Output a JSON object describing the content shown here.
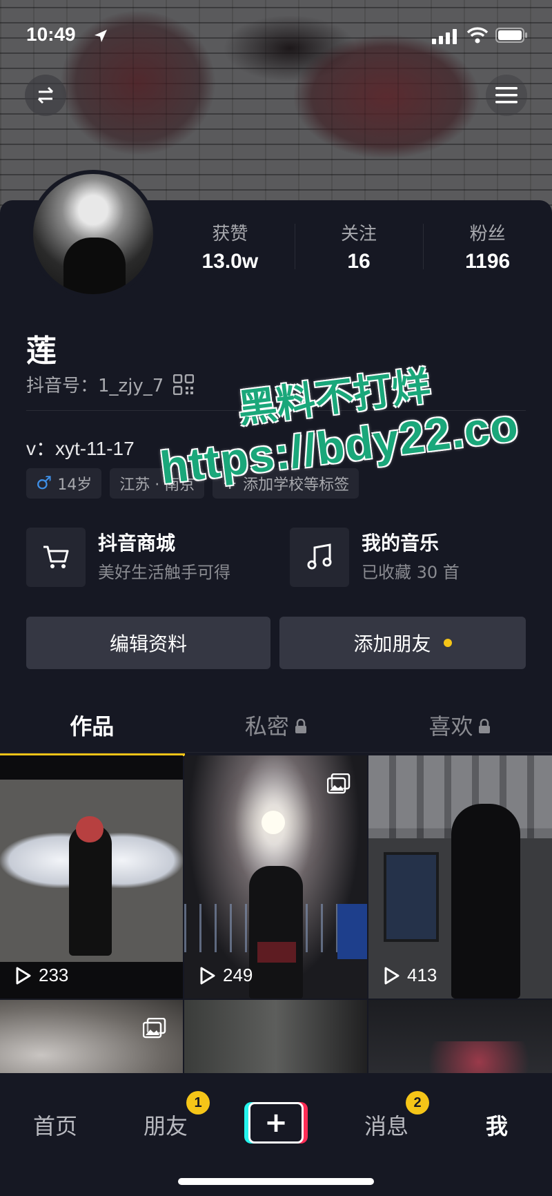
{
  "status_bar": {
    "time": "10:49"
  },
  "profile": {
    "nickname": "莲",
    "douyin_id": "抖音号：1_zjy_7",
    "bio": "v：xyt-11-17",
    "tags": {
      "age": "14岁",
      "location": "江苏 · 南京",
      "add_tag": "添加学校等标签"
    },
    "stats": [
      {
        "label": "获赞",
        "value": "13.0w"
      },
      {
        "label": "关注",
        "value": "16"
      },
      {
        "label": "粉丝",
        "value": "1196"
      }
    ]
  },
  "services": [
    {
      "title": "抖音商城",
      "subtitle": "美好生活触手可得",
      "icon": "cart-icon"
    },
    {
      "title": "我的音乐",
      "subtitle": "已收藏 30 首",
      "icon": "music-note-icon"
    }
  ],
  "actions": {
    "edit_profile": "编辑资料",
    "add_friend": "添加朋友"
  },
  "tabs": [
    {
      "label": "作品",
      "active": true
    },
    {
      "label": "私密",
      "locked": true
    },
    {
      "label": "喜欢",
      "locked": true
    }
  ],
  "videos": [
    {
      "plays": "233"
    },
    {
      "plays": "249",
      "type": "image-set"
    },
    {
      "plays": "413"
    },
    {
      "type": "image-set"
    },
    {},
    {}
  ],
  "watermark": {
    "line1": "黑料不打烊",
    "line2": "https://bdy22.co"
  },
  "bottom_nav": {
    "home": "首页",
    "friends": "朋友",
    "friends_badge": "1",
    "add": "+",
    "messages": "消息",
    "messages_badge": "2",
    "me": "我"
  },
  "colors": {
    "accent": "#f5c518",
    "background": "#161823",
    "male": "#3e90e8",
    "watermark": "#1aa77a"
  }
}
